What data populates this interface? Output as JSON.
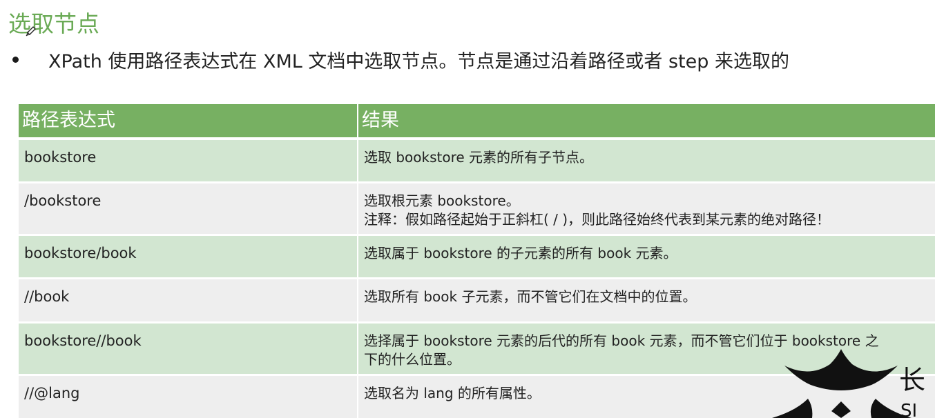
{
  "slide": {
    "title": "选取节点",
    "bullet_text": "XPath 使用路径表达式在 XML 文档中选取节点。节点是通过沿着路径或者 step 来选取的"
  },
  "table": {
    "headers": [
      "路径表达式",
      "结果"
    ],
    "rows": [
      {
        "expression": "bookstore",
        "result_lines": [
          "选取 bookstore 元素的所有子节点。"
        ]
      },
      {
        "expression": "/bookstore",
        "result_lines": [
          "选取根元素 bookstore。",
          "注释：假如路径起始于正斜杠( / )，则此路径始终代表到某元素的绝对路径！"
        ]
      },
      {
        "expression": "bookstore/book",
        "result_lines": [
          "选取属于 bookstore 的子元素的所有 book 元素。"
        ]
      },
      {
        "expression": "//book",
        "result_lines": [
          "选取所有 book 子元素，而不管它们在文档中的位置。"
        ]
      },
      {
        "expression": "bookstore//book",
        "result_lines": [
          "选择属于 bookstore 元素的后代的所有 book 元素，而不管它们位于 bookstore 之",
          "下的什么位置。"
        ]
      },
      {
        "expression": "//@lang",
        "result_lines": [
          "选取名为 lang 的所有属性。"
        ]
      }
    ]
  },
  "logo": {
    "text_fragment": "长",
    "text_fragment_2": "SI"
  },
  "colors": {
    "title_green": "#6aaa55",
    "header_green": "#77b062",
    "row_green": "#d2e6d1",
    "row_gray": "#eeeeee"
  }
}
